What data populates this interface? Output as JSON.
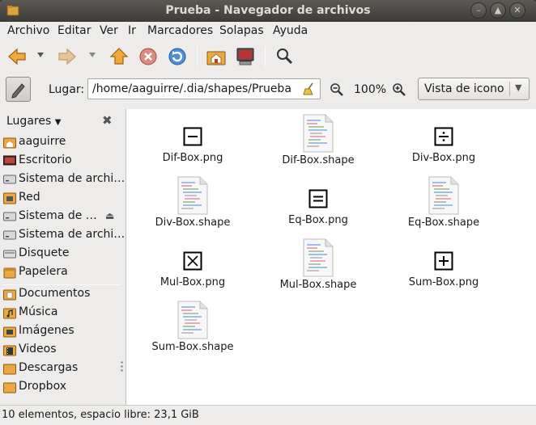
{
  "window": {
    "title": "Prueba - Navegador de archivos"
  },
  "menubar": [
    "Archivo",
    "Editar",
    "Ver",
    "Ir",
    "Marcadores",
    "Solapas",
    "Ayuda"
  ],
  "location": {
    "label": "Lugar:",
    "path": "/home/aaguirre/.dia/shapes/Prueba"
  },
  "zoom": {
    "level": "100%"
  },
  "view": {
    "selected": "Vista de icono"
  },
  "sidebar": {
    "header": "Lugares",
    "items": [
      {
        "label": "aaguirre",
        "icon": "home-folder-icon"
      },
      {
        "label": "Escritorio",
        "icon": "desktop-icon"
      },
      {
        "label": "Sistema de archi…",
        "icon": "drive-icon"
      },
      {
        "label": "Red",
        "icon": "network-icon"
      },
      {
        "label": "Sistema de …",
        "icon": "drive-icon",
        "eject": true
      },
      {
        "label": "Sistema de archi…",
        "icon": "drive-icon"
      },
      {
        "label": "Disquete",
        "icon": "floppy-icon"
      },
      {
        "label": "Papelera",
        "icon": "trash-icon"
      },
      {
        "label": "Documentos",
        "icon": "documents-folder-icon"
      },
      {
        "label": "Música",
        "icon": "music-folder-icon"
      },
      {
        "label": "Imágenes",
        "icon": "pictures-folder-icon"
      },
      {
        "label": "Videos",
        "icon": "videos-folder-icon"
      },
      {
        "label": "Descargas",
        "icon": "downloads-folder-icon"
      },
      {
        "label": "Dropbox",
        "icon": "folder-icon"
      }
    ]
  },
  "files": [
    {
      "name": "Dif-Box.png",
      "kind": "png",
      "symbol": "minus"
    },
    {
      "name": "Dif-Box.shape",
      "kind": "shape"
    },
    {
      "name": "Div-Box.png",
      "kind": "png",
      "symbol": "divide"
    },
    {
      "name": "Div-Box.shape",
      "kind": "shape"
    },
    {
      "name": "Eq-Box.png",
      "kind": "png",
      "symbol": "equals"
    },
    {
      "name": "Eq-Box.shape",
      "kind": "shape"
    },
    {
      "name": "Mul-Box.png",
      "kind": "png",
      "symbol": "times"
    },
    {
      "name": "Mul-Box.shape",
      "kind": "shape"
    },
    {
      "name": "Sum-Box.png",
      "kind": "png",
      "symbol": "plus"
    },
    {
      "name": "Sum-Box.shape",
      "kind": "shape"
    }
  ],
  "status": "10 elementos, espacio libre: 23,1 GiB"
}
